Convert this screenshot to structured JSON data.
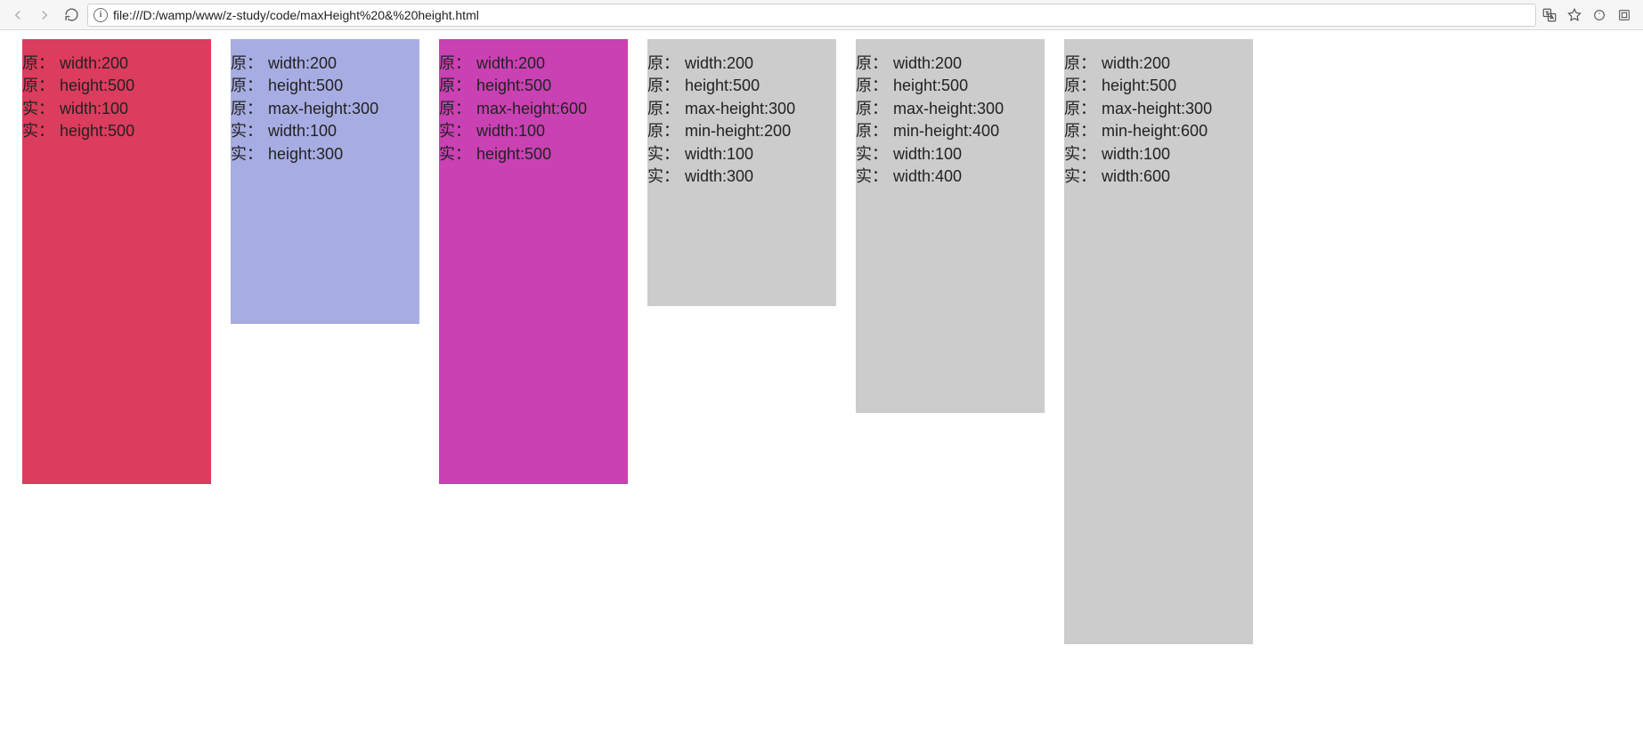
{
  "browser": {
    "url": "file:///D:/wamp/www/z-study/code/maxHeight%20&%20height.html"
  },
  "boxes": [
    {
      "colorClass": "c-red",
      "heightClass": "h500",
      "lines": [
        {
          "label": "原：",
          "value": "width:200"
        },
        {
          "label": "原：",
          "value": "height:500"
        },
        {
          "label": "实：",
          "value": "width:100"
        },
        {
          "label": "实：",
          "value": "height:500"
        }
      ]
    },
    {
      "colorClass": "c-purple",
      "heightClass": "h320",
      "lines": [
        {
          "label": "原：",
          "value": "width:200"
        },
        {
          "label": "原：",
          "value": "height:500"
        },
        {
          "label": "原：",
          "value": "max-height:300"
        },
        {
          "label": "实：",
          "value": "width:100"
        },
        {
          "label": "实：",
          "value": "height:300"
        }
      ]
    },
    {
      "colorClass": "c-pink",
      "heightClass": "h500",
      "lines": [
        {
          "label": "原：",
          "value": "width:200"
        },
        {
          "label": "原：",
          "value": "height:500"
        },
        {
          "label": "原：",
          "value": "max-height:600"
        },
        {
          "label": "实：",
          "value": "width:100"
        },
        {
          "label": "实：",
          "value": "height:500"
        }
      ]
    },
    {
      "colorClass": "c-grey",
      "heightClass": "h300",
      "lines": [
        {
          "label": "原：",
          "value": "width:200"
        },
        {
          "label": "原：",
          "value": "height:500"
        },
        {
          "label": "原：",
          "value": "max-height:300"
        },
        {
          "label": "原：",
          "value": "min-height:200"
        },
        {
          "label": "实：",
          "value": "width:100"
        },
        {
          "label": "实：",
          "value": "width:300"
        }
      ]
    },
    {
      "colorClass": "c-grey",
      "heightClass": "h420",
      "lines": [
        {
          "label": "原：",
          "value": "width:200"
        },
        {
          "label": "原：",
          "value": "height:500"
        },
        {
          "label": "原：",
          "value": "max-height:300"
        },
        {
          "label": "原：",
          "value": "min-height:400"
        },
        {
          "label": "实：",
          "value": "width:100"
        },
        {
          "label": "实：",
          "value": "width:400"
        }
      ]
    },
    {
      "colorClass": "c-grey",
      "heightClass": "h680",
      "lines": [
        {
          "label": "原：",
          "value": "width:200"
        },
        {
          "label": "原：",
          "value": "height:500"
        },
        {
          "label": "原：",
          "value": "max-height:300"
        },
        {
          "label": "原：",
          "value": "min-height:600"
        },
        {
          "label": "实：",
          "value": "width:100"
        },
        {
          "label": "实：",
          "value": "width:600"
        }
      ]
    }
  ]
}
